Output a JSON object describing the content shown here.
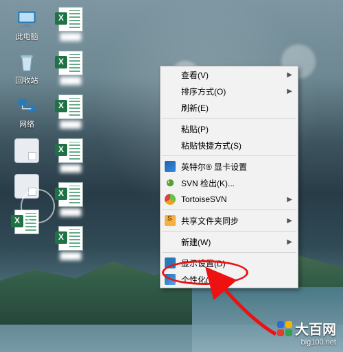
{
  "desktop": {
    "icons_col1": [
      {
        "kind": "pc",
        "label": "此电脑"
      },
      {
        "kind": "bin",
        "label": "回收站"
      },
      {
        "kind": "net",
        "label": "网络"
      },
      {
        "kind": "generic",
        "label": "",
        "blurred": true
      },
      {
        "kind": "generic",
        "label": "",
        "blurred": true
      },
      {
        "kind": "excel",
        "label": "",
        "blurred": true
      }
    ],
    "icons_col2": [
      {
        "kind": "excel",
        "label": "",
        "blurred": true
      },
      {
        "kind": "excel",
        "label": "",
        "blurred": true
      },
      {
        "kind": "excel",
        "label": "",
        "blurred": true
      },
      {
        "kind": "excel",
        "label": "",
        "blurred": true
      },
      {
        "kind": "excel",
        "label": "",
        "blurred": true
      },
      {
        "kind": "excel",
        "label": "",
        "blurred": true
      }
    ]
  },
  "context_menu": {
    "groups": [
      [
        {
          "label": "查看(V)",
          "submenu": true
        },
        {
          "label": "排序方式(O)",
          "submenu": true
        },
        {
          "label": "刷新(E)"
        }
      ],
      [
        {
          "label": "粘贴(P)"
        },
        {
          "label": "粘贴快捷方式(S)"
        }
      ],
      [
        {
          "icon": "intel",
          "label": "英特尔® 显卡设置"
        },
        {
          "icon": "svnco",
          "label": "SVN 检出(K)..."
        },
        {
          "icon": "tort",
          "label": "TortoiseSVN",
          "submenu": true
        }
      ],
      [
        {
          "icon": "share",
          "label": "共享文件夹同步",
          "submenu": true
        }
      ],
      [
        {
          "label": "新建(W)",
          "submenu": true
        }
      ],
      [
        {
          "icon": "disp",
          "label": "显示设置(D)"
        },
        {
          "icon": "pers",
          "label": "个性化(R)",
          "highlight": true
        }
      ]
    ]
  },
  "watermark": {
    "brand": "大百网",
    "url": "big100.net"
  },
  "annotation": {
    "target": "个性化(R)"
  }
}
